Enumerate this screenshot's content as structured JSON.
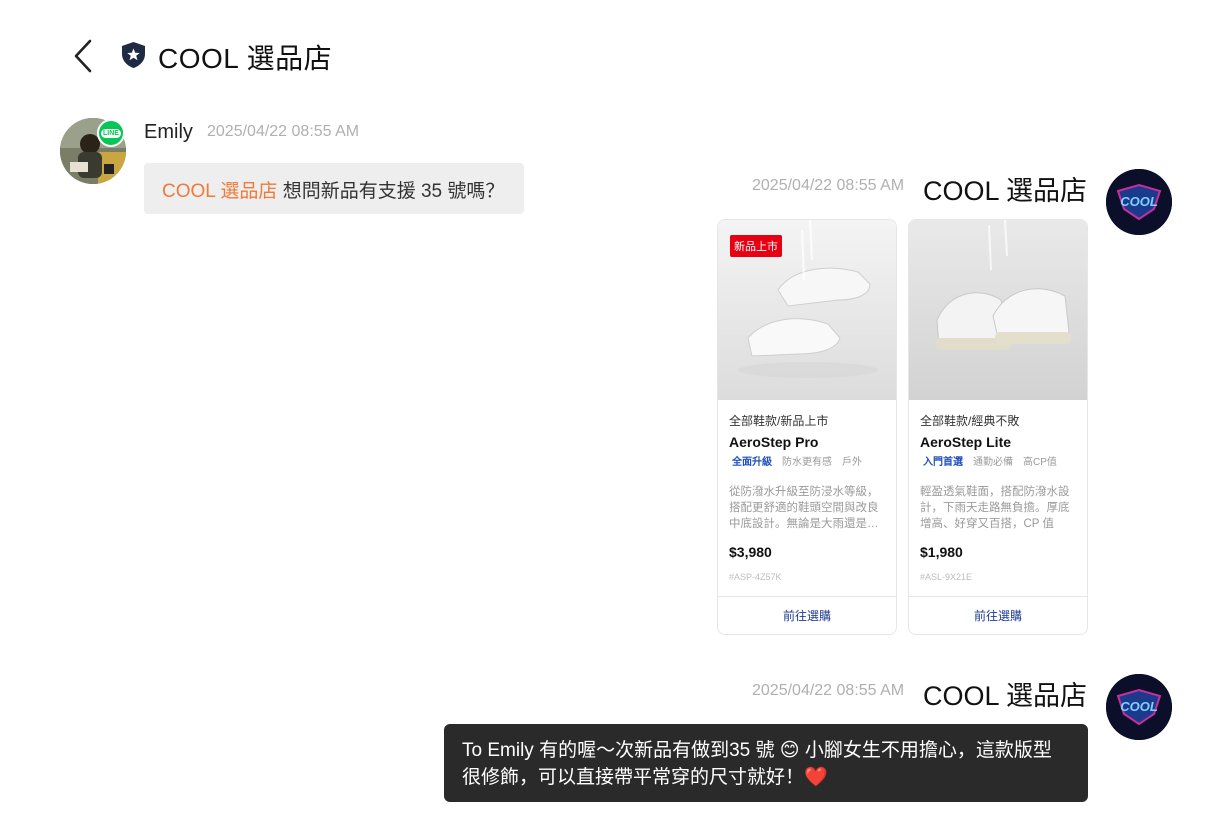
{
  "header": {
    "back_icon": "chevron-left-icon",
    "shop_icon": "shield-star-icon",
    "title": "COOL 選品店"
  },
  "messages": {
    "emily": {
      "name": "Emily",
      "timestamp": "2025/04/22 08:55 AM",
      "mention": "COOL 選品店",
      "text": " 想問新品有支援 35 號嗎？",
      "badge_icon": "line-app-icon",
      "badge_text": "LINE"
    },
    "shop_cards": {
      "timestamp": "2025/04/22 08:55 AM",
      "name": "COOL 選品店"
    },
    "shop_reply": {
      "timestamp": "2025/04/22 08:55 AM",
      "name": "COOL 選品店",
      "line1": "To Emily 有的喔～次新品有做到35 號 😊 小腳女生不用擔心，這款版型",
      "line2": "很修飾，可以直接帶平常穿的尺寸就好！",
      "heart": "❤️"
    }
  },
  "products": [
    {
      "badge": "新品上市",
      "category": "全部鞋款/新品上市",
      "name": "AeroStep Pro",
      "tags": [
        "全面升級",
        "防水更有感",
        "戶外"
      ],
      "description": "從防潑水升級至防浸水等級，搭配更舒適的鞋頭空間與改良中底設計。無論是大雨還是…",
      "price": "$3,980",
      "sku": "#ASP-4Z57K",
      "button": "前往選購"
    },
    {
      "category": "全部鞋款/經典不敗",
      "name": "AeroStep Lite",
      "tags": [
        "入門首選",
        "通勤必備",
        "高CP值"
      ],
      "description": "輕盈透氣鞋面，搭配防潑水設計，下雨天走路無負擔。厚底增高、好穿又百搭，CP 值超…",
      "price": "$1,980",
      "sku": "#ASL-9X21E",
      "button": "前往選購"
    }
  ],
  "colors": {
    "mention": "#ef7a3b",
    "line_green": "#06c755",
    "new_tag_red": "#e60012",
    "tag_blue": "#1f4fbf",
    "dark_bubble": "#2a2a2a"
  }
}
